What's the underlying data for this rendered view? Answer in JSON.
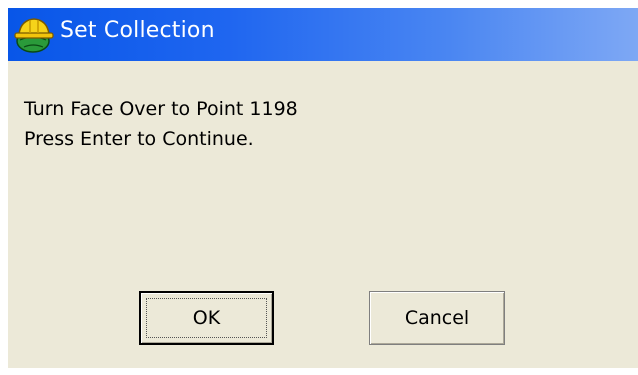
{
  "window": {
    "title": "Set Collection",
    "icon": "surveyor-hardhat-globe-icon",
    "titlebar_color_start": "#0856e8",
    "titlebar_color_end": "#7ea8f4",
    "background": "#ece9d8"
  },
  "message": {
    "line1": "Turn Face Over to Point 1198",
    "line2": "Press Enter to Continue."
  },
  "buttons": {
    "ok_label": "OK",
    "cancel_label": "Cancel"
  }
}
